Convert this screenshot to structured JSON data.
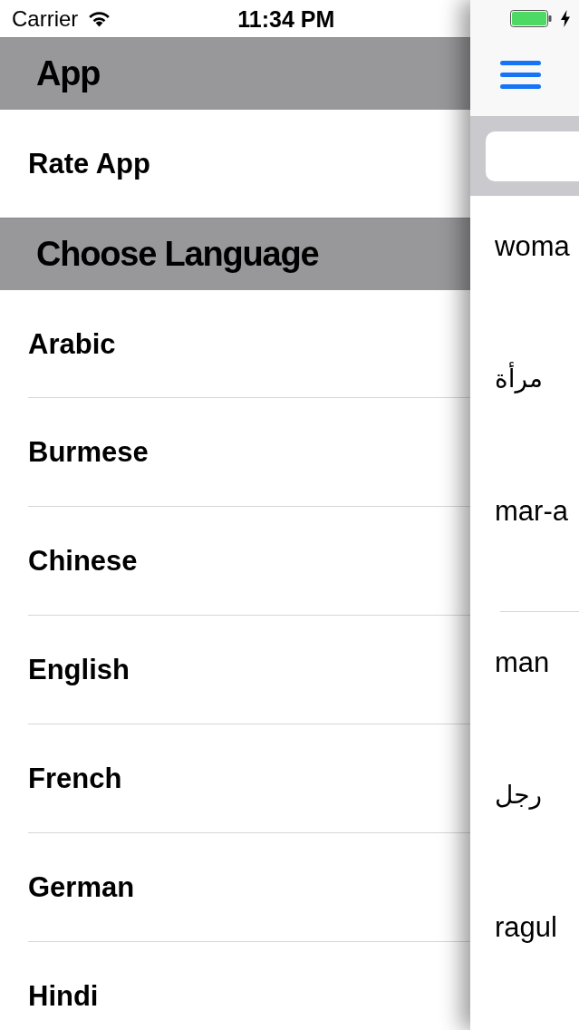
{
  "status_bar": {
    "carrier": "Carrier",
    "time": "11:34 PM",
    "charging": true
  },
  "drawer": {
    "sections": [
      {
        "title": "App",
        "items": [
          {
            "label": "Rate App"
          }
        ]
      },
      {
        "title": "Choose Language",
        "items": [
          {
            "label": "Arabic"
          },
          {
            "label": "Burmese"
          },
          {
            "label": "Chinese"
          },
          {
            "label": "English"
          },
          {
            "label": "French"
          },
          {
            "label": "German"
          },
          {
            "label": "Hindi"
          }
        ]
      }
    ]
  },
  "entries": [
    {
      "english": "woma",
      "arabic": "مرأة",
      "transliteration": "mar-a"
    },
    {
      "english": "man",
      "arabic": "رجل",
      "transliteration": "ragul"
    }
  ]
}
